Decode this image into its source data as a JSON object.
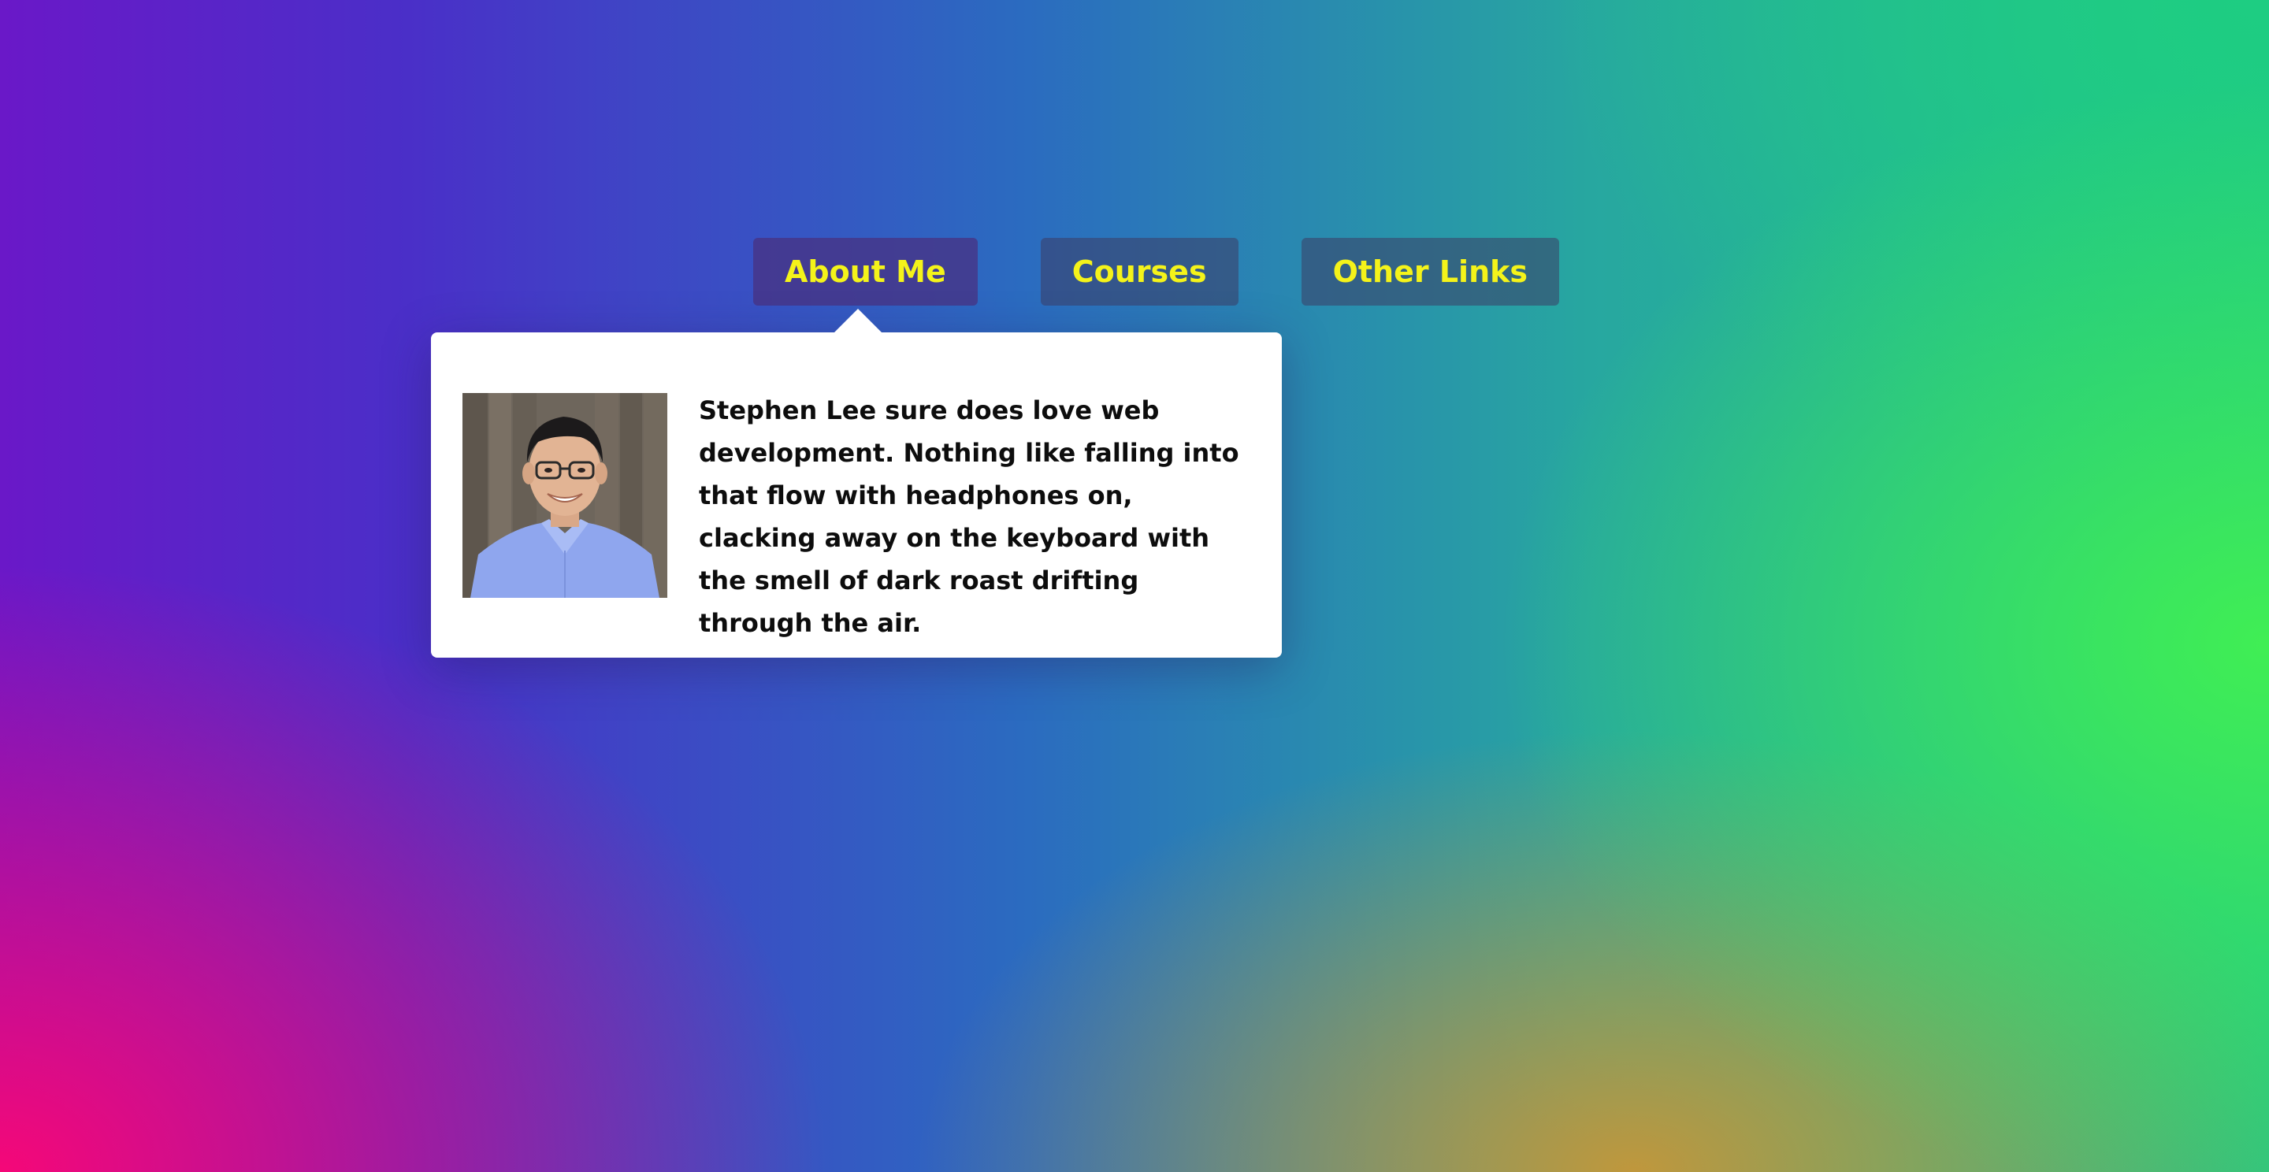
{
  "nav": {
    "items": [
      {
        "label": "About Me",
        "active": true
      },
      {
        "label": "Courses",
        "active": false
      },
      {
        "label": "Other Links",
        "active": false
      }
    ]
  },
  "popup": {
    "bio": "Stephen Lee sure does love web development. Nothing like falling into that flow with headphones on, clacking away on the keyboard with the smell of dark roast drifting through the air."
  },
  "colors": {
    "nav_text": "#f4f31a",
    "popup_background": "#ffffff",
    "gradient_pink": "#f50878",
    "gradient_green": "#40ee54",
    "gradient_purple": "#6a18c8"
  }
}
